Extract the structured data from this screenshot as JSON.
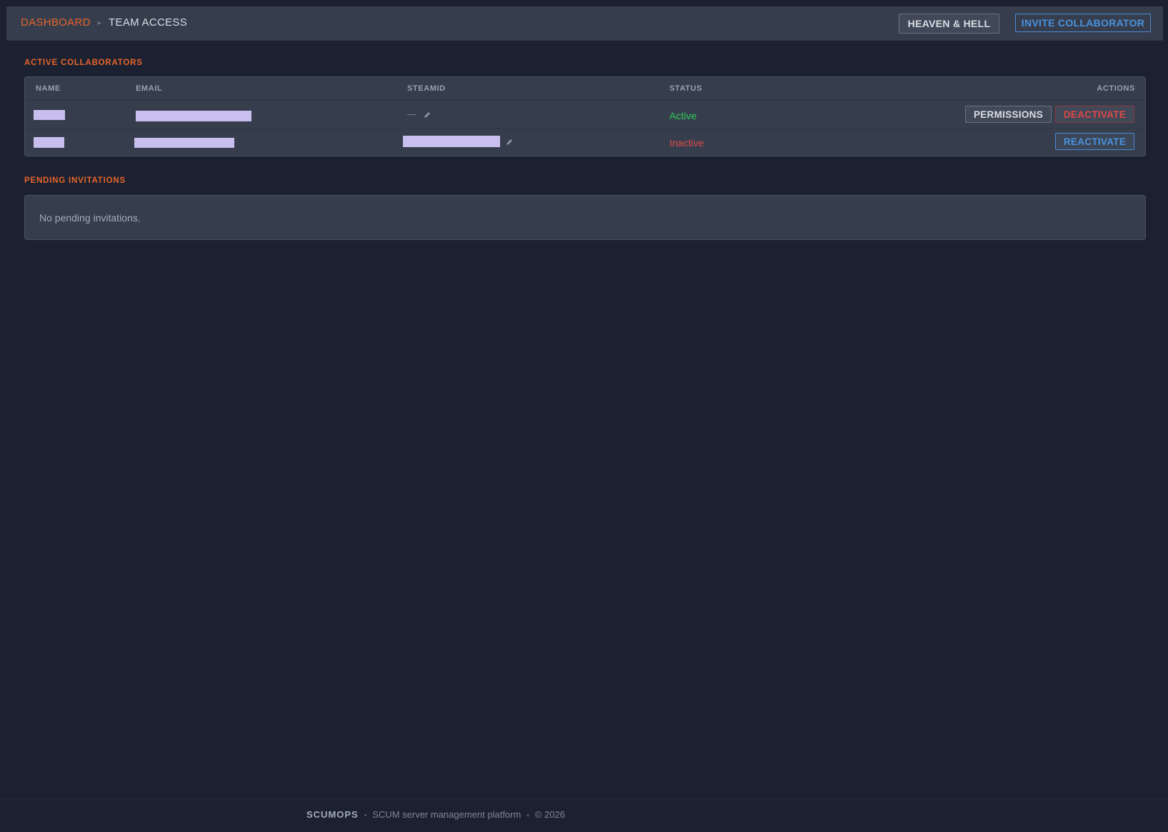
{
  "breadcrumb": {
    "root": "DASHBOARD",
    "separator": "▸",
    "current": "TEAM ACCESS"
  },
  "header_actions": {
    "server_label": "HEAVEN & HELL",
    "invite_label": "INVITE COLLABORATOR"
  },
  "active": {
    "title": "ACTIVE COLLABORATORS",
    "columns": [
      "NAME",
      "EMAIL",
      "STEAMID",
      "STATUS",
      "ACTIONS"
    ],
    "rows": [
      {
        "steamid": "—",
        "status": "Active",
        "actions": [
          "PERMISSIONS",
          "DEACTIVATE"
        ]
      },
      {
        "steamid": "",
        "status": "Inactive",
        "actions": [
          "REACTIVATE"
        ]
      }
    ]
  },
  "pending": {
    "title": "PENDING INVITATIONS",
    "empty_text": "No pending invitations."
  },
  "footer": {
    "brand": "SCUMOPS",
    "dot": "•",
    "tagline": "SCUM server management platform",
    "copyright": "© 2026"
  },
  "colors": {
    "accent": "#e8642c",
    "active": "#2ecc55",
    "inactive": "#e04848",
    "link": "#4a92e0"
  },
  "icons": {
    "steamid_edit": "pencil-icon"
  }
}
